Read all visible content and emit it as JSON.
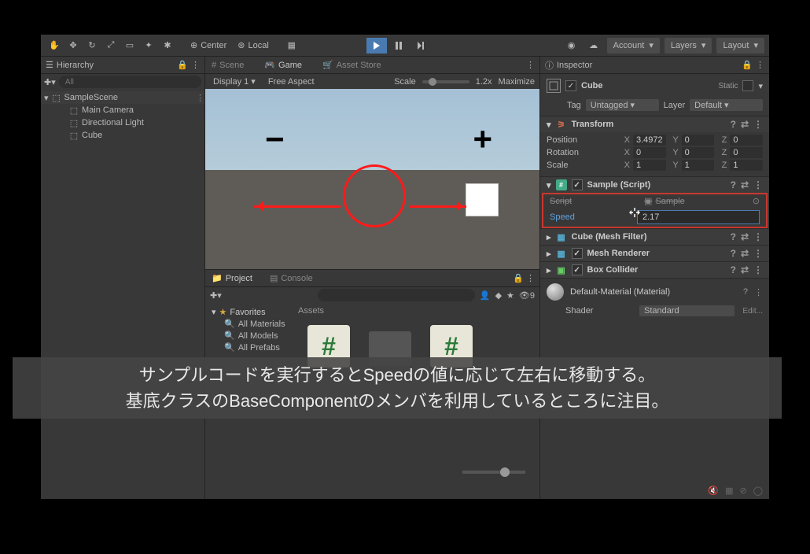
{
  "toolbar": {
    "center_label": "Center",
    "local_label": "Local",
    "account_label": "Account",
    "layers_label": "Layers",
    "layout_label": "Layout"
  },
  "hierarchy": {
    "title": "Hierarchy",
    "search_placeholder": "All",
    "scene": "SampleScene",
    "items": [
      "Main Camera",
      "Directional Light",
      "Cube"
    ]
  },
  "center_tabs": {
    "scene": "Scene",
    "game": "Game",
    "asset_store": "Asset Store"
  },
  "game_bar": {
    "display": "Display 1",
    "aspect": "Free Aspect",
    "scale_label": "Scale",
    "scale_value": "1.2x",
    "maximize": "Maximize"
  },
  "project": {
    "project_tab": "Project",
    "console_tab": "Console",
    "favorites": "Favorites",
    "all_materials": "All Materials",
    "all_models": "All Models",
    "all_prefabs": "All Prefabs",
    "assets_label": "Assets"
  },
  "inspector": {
    "title": "Inspector",
    "object_name": "Cube",
    "static_label": "Static",
    "tag_label": "Tag",
    "tag_value": "Untagged",
    "layer_label": "Layer",
    "layer_value": "Default",
    "transform": {
      "title": "Transform",
      "position_label": "Position",
      "rotation_label": "Rotation",
      "scale_label": "Scale",
      "pos": {
        "x": "3.4972",
        "y": "0",
        "z": "0"
      },
      "rot": {
        "x": "0",
        "y": "0",
        "z": "0"
      },
      "scl": {
        "x": "1",
        "y": "1",
        "z": "1"
      }
    },
    "sample": {
      "title": "Sample (Script)",
      "script_label": "Script",
      "script_value": "Sample",
      "speed_label": "Speed",
      "speed_value": "2.17"
    },
    "mesh_filter": "Cube (Mesh Filter)",
    "mesh_renderer": "Mesh Renderer",
    "box_collider": "Box Collider",
    "material": {
      "title": "Default-Material (Material)",
      "shader_label": "Shader",
      "shader_value": "Standard",
      "edit": "Edit..."
    }
  },
  "overlay": {
    "line1": "サンプルコードを実行するとSpeedの値に応じて左右に移動する。",
    "line2": "基底クラスのBaseComponentのメンバを利用しているところに注目。"
  }
}
